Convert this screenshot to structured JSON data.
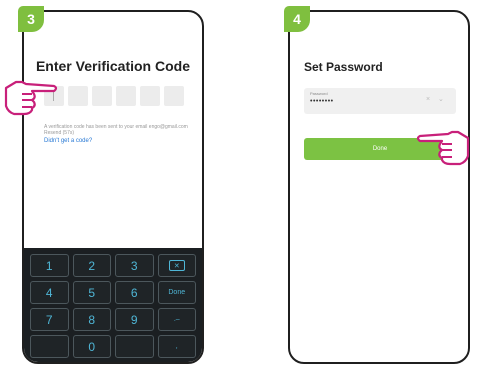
{
  "steps": {
    "left": "3",
    "right": "4"
  },
  "verification": {
    "title": "Enter Verification Code",
    "info_text": "A verification code has been sent to your email engo@gmail.com Resend (57s)",
    "resend_link": "Didn't get a code?"
  },
  "keypad": {
    "keys": [
      "1",
      "2",
      "3",
      "",
      "4",
      "5",
      "6",
      "Done",
      "7",
      "8",
      "9",
      ".–",
      "",
      "0",
      "",
      ","
    ]
  },
  "password": {
    "title": "Set Password",
    "field_label": "Password",
    "field_value": "••••••••",
    "clear_icon": "×",
    "eye_icon": "⌄",
    "done_label": "Done"
  },
  "colors": {
    "accent": "#7cc243",
    "keypad_bg": "#1b1f22",
    "key_text": "#4fb6d6"
  }
}
